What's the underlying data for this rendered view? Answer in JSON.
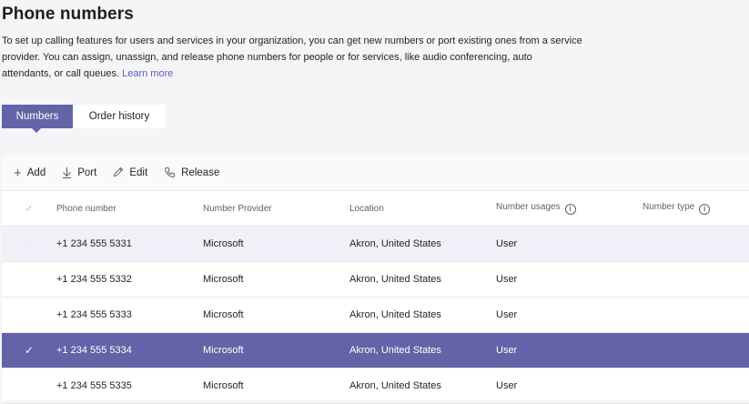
{
  "header": {
    "title": "Phone numbers",
    "description": "To set up calling features for users and services in your organization, you can get new numbers or port existing ones from a service provider. You can assign, unassign, and release phone numbers for people or for services, like audio conferencing, auto attendants, or call queues.",
    "learn_more": "Learn more"
  },
  "tabs": [
    {
      "label": "Numbers",
      "active": true
    },
    {
      "label": "Order history",
      "active": false
    }
  ],
  "toolbar": {
    "add": "Add",
    "port": "Port",
    "edit": "Edit",
    "release": "Release"
  },
  "table": {
    "columns": {
      "phone": "Phone number",
      "provider": "Number Provider",
      "location": "Location",
      "usage": "Number usages",
      "type": "Number type"
    },
    "rows": [
      {
        "phone": "+1 234 555 5331",
        "provider": "Microsoft",
        "location": "Akron, United States",
        "usage": "User",
        "type": "",
        "state": "hover"
      },
      {
        "phone": "+1 234 555 5332",
        "provider": "Microsoft",
        "location": "Akron, United States",
        "usage": "User",
        "type": "",
        "state": "normal"
      },
      {
        "phone": "+1 234 555 5333",
        "provider": "Microsoft",
        "location": "Akron, United States",
        "usage": "User",
        "type": "",
        "state": "normal"
      },
      {
        "phone": "+1 234 555 5334",
        "provider": "Microsoft",
        "location": "Akron, United States",
        "usage": "User",
        "type": "",
        "state": "selected"
      },
      {
        "phone": "+1 234 555 5335",
        "provider": "Microsoft",
        "location": "Akron, United States",
        "usage": "User",
        "type": "",
        "state": "normal"
      }
    ]
  },
  "colors": {
    "accent": "#6264a7",
    "link": "#5b5fc7",
    "page_bg": "#f5f4f7"
  }
}
